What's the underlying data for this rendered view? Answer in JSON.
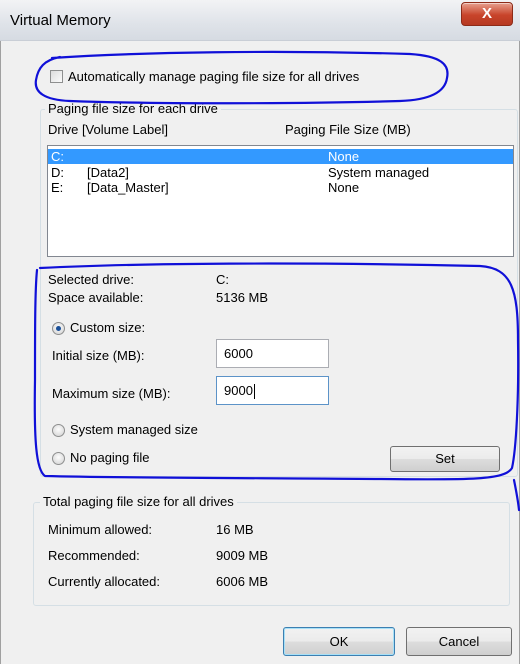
{
  "window": {
    "title": "Virtual Memory",
    "close_glyph": "X"
  },
  "auto_manage": {
    "label": "Automatically manage paging file size for all drives",
    "checked": false
  },
  "per_drive": {
    "group_title": "Paging file size for each drive",
    "col_drive": "Drive  [Volume Label]",
    "col_size": "Paging File Size (MB)",
    "drives": [
      {
        "letter": "C:",
        "label": "",
        "size": "None",
        "selected": true
      },
      {
        "letter": "D:",
        "label": "[Data2]",
        "size": "System managed",
        "selected": false
      },
      {
        "letter": "E:",
        "label": "[Data_Master]",
        "size": "None",
        "selected": false
      }
    ]
  },
  "selected": {
    "drive_label": "Selected drive:",
    "drive_value": "C:",
    "space_label": "Space available:",
    "space_value": "5136 MB"
  },
  "options": {
    "custom_label": "Custom size:",
    "initial_label": "Initial size (MB):",
    "initial_value": "6000",
    "maximum_label": "Maximum size (MB):",
    "maximum_value": "9000",
    "system_label": "System managed size",
    "none_label": "No paging file",
    "set_label": "Set",
    "selected_option": "custom"
  },
  "totals": {
    "group_title": "Total paging file size for all drives",
    "min_label": "Minimum allowed:",
    "min_value": "16 MB",
    "rec_label": "Recommended:",
    "rec_value": "9009 MB",
    "cur_label": "Currently allocated:",
    "cur_value": "6006 MB"
  },
  "buttons": {
    "ok_label": "OK",
    "cancel_label": "Cancel"
  },
  "colors": {
    "selection": "#3399ff",
    "annotation_ink": "#1010d8",
    "close_button": "#c8442a"
  }
}
